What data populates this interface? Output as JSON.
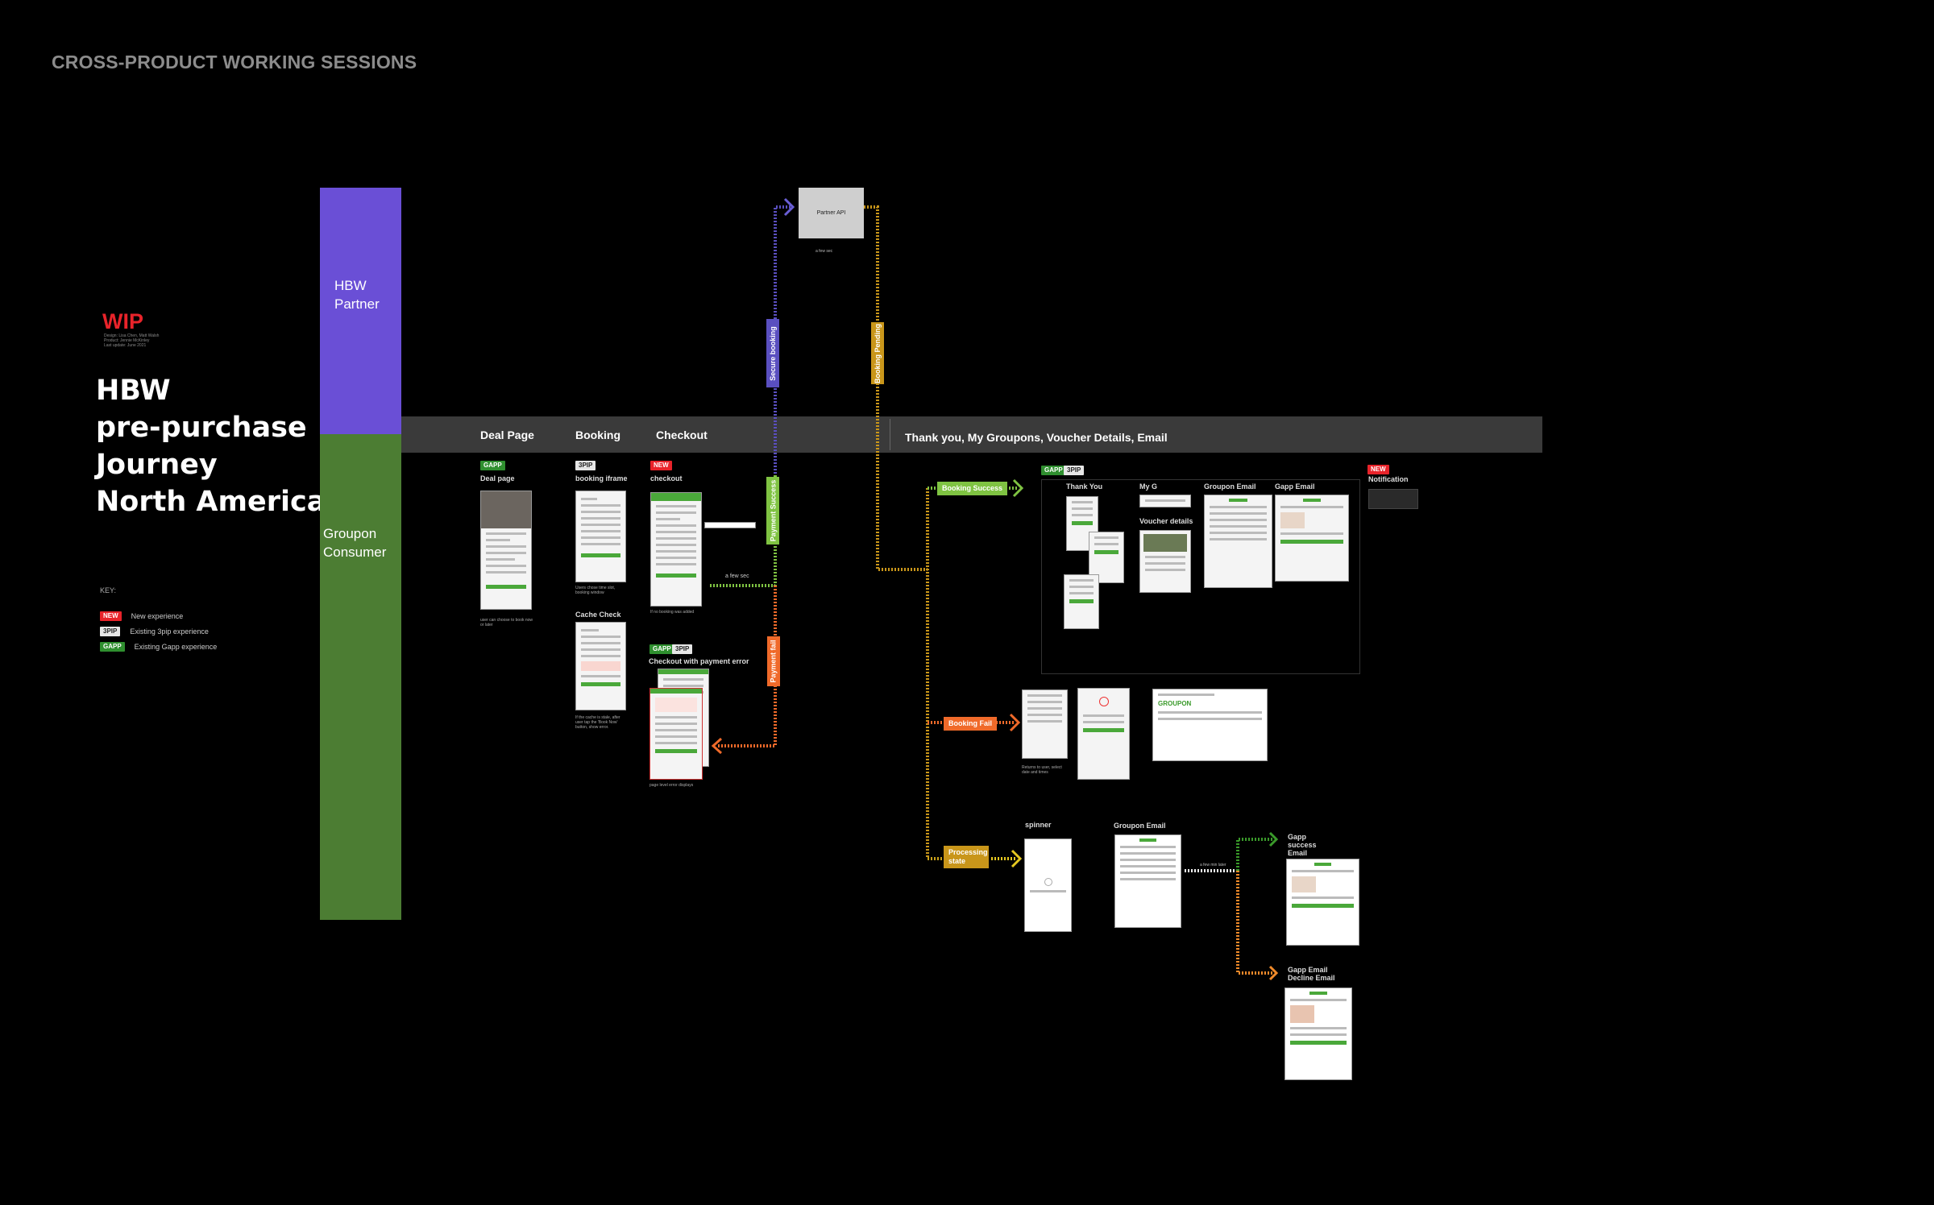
{
  "header": {
    "title": "CROSS-PRODUCT WORKING SESSIONS"
  },
  "wip": {
    "label": "WIP",
    "sub1": "Design: Lisa Chen, Matt Walsh",
    "sub2": "Product: Jennie McKinley",
    "sub3": "Last update: June 2021"
  },
  "title": {
    "line1": "HBW",
    "line2": "pre-purchase",
    "line3": "Journey",
    "line4": "North America"
  },
  "key": {
    "heading": "KEY:",
    "items": [
      {
        "badge": "NEW",
        "label": "New experience"
      },
      {
        "badge": "3PIP",
        "label": "Existing 3pip experience"
      },
      {
        "badge": "GAPP",
        "label": "Existing Gapp experience"
      }
    ]
  },
  "lanes": {
    "partner_l1": "HBW",
    "partner_l2": "Partner",
    "consumer_l1": "Groupon",
    "consumer_l2": "Consumer"
  },
  "columns": {
    "deal": "Deal Page",
    "booking": "Booking",
    "checkout": "Checkout",
    "thanks": "Thank you,  My Groupons, Voucher Details, Email"
  },
  "screens": {
    "deal_badge": "GAPP",
    "deal_label": "Deal page",
    "deal_note": "user can choose to book now or later",
    "booking_badge": "3PIP",
    "booking_label": "booking iframe",
    "cache_label": "Cache Check",
    "checkout_badge": "NEW",
    "checkout_label": "checkout",
    "error_badge1": "GAPP",
    "error_badge2": "3PIP",
    "error_label": "Checkout with payment error",
    "error_note": "page level error displays"
  },
  "partner_api": {
    "label": "Partner API",
    "note": "a few sec"
  },
  "flows": {
    "secure": "Secure booking",
    "pending": "Booking Pending",
    "pay_success": "Payment Success",
    "pay_fail": "Payment fail",
    "few_sec": "a few sec",
    "booking_success": "Booking Success",
    "booking_fail": "Booking Fail",
    "processing": "Processing state",
    "later": "a few min later"
  },
  "success_group": {
    "badge1": "GAPP",
    "badge2": "3PIP",
    "thank_you": "Thank You",
    "my_g": "My G",
    "voucher": "Voucher details",
    "groupon_email": "Groupon Email",
    "gapp_email": "Gapp Email",
    "notif_badge": "NEW",
    "notification": "Notification"
  },
  "fail_group": {
    "fail_logo": "GROUPON"
  },
  "processing_group": {
    "spinner": "spinner",
    "groupon_email": "Groupon Email",
    "gapp_success": "Gapp  success Email",
    "gapp_decline": "Gapp Email Decline Email"
  },
  "colors": {
    "partner": "#6a4fd6",
    "consumer": "#4c7d33",
    "secure": "#5a4fc0",
    "pending": "#c9961a",
    "success": "#7fc342",
    "fail": "#f06a2a",
    "processing": "#c9a11a"
  }
}
